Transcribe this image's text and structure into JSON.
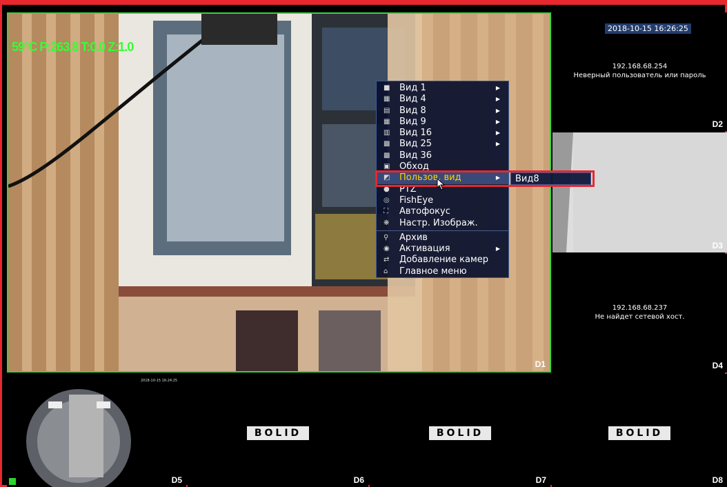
{
  "tiles": {
    "main": {
      "channel": "D1",
      "ptz_overlay": "59°C P:263.8 T:0.0 Z:1.0"
    },
    "right1": {
      "channel": "D2",
      "timestamp": "2018-10-15 16:26:25",
      "ip": "192.168.68.254",
      "message": "Неверный пользователь или пароль"
    },
    "right2": {
      "channel": "D3"
    },
    "right3": {
      "channel": "D4",
      "ip": "192.168.68.237",
      "message": "Не найдет сетевой хост."
    },
    "bottom1": {
      "channel": "D5",
      "timestamp": "2018-10-15 16:24:25"
    },
    "bottom2": {
      "channel": "D6",
      "logo": "BOLID"
    },
    "bottom3": {
      "channel": "D7",
      "logo": "BOLID"
    },
    "bottom4": {
      "channel": "D8",
      "logo": "BOLID"
    }
  },
  "menu": {
    "items": [
      {
        "label": "Вид 1",
        "icon": "layout-1-icon",
        "has_sub": true
      },
      {
        "label": "Вид 4",
        "icon": "layout-4-icon",
        "has_sub": true
      },
      {
        "label": "Вид 8",
        "icon": "layout-8-icon",
        "has_sub": true
      },
      {
        "label": "Вид 9",
        "icon": "layout-9-icon",
        "has_sub": true
      },
      {
        "label": "Вид 16",
        "icon": "layout-16-icon",
        "has_sub": true
      },
      {
        "label": "Вид 25",
        "icon": "layout-25-icon",
        "has_sub": true
      },
      {
        "label": "Вид 36",
        "icon": "layout-36-icon",
        "has_sub": false
      },
      {
        "label": "Обход",
        "icon": "tour-icon",
        "has_sub": false
      },
      {
        "label": "Пользов. вид",
        "icon": "custom-view-icon",
        "has_sub": true,
        "active": true
      },
      {
        "label": "PTZ",
        "icon": "ptz-icon",
        "has_sub": false
      },
      {
        "label": "FishEye",
        "icon": "fisheye-icon",
        "has_sub": false
      },
      {
        "label": "Автофокус",
        "icon": "autofocus-icon",
        "has_sub": false
      },
      {
        "label": "Настр. Изображ.",
        "icon": "image-settings-icon",
        "has_sub": false
      },
      {
        "label": "Архив",
        "icon": "search-icon",
        "has_sub": false
      },
      {
        "label": "Активация",
        "icon": "activation-icon",
        "has_sub": true
      },
      {
        "label": "Добавление камер",
        "icon": "add-camera-icon",
        "has_sub": false
      },
      {
        "label": "Главное меню",
        "icon": "home-icon",
        "has_sub": false
      }
    ],
    "submenu_item": "Вид8"
  },
  "colors": {
    "highlight": "#e8272f",
    "active_border": "#3bd43b",
    "menu_active_text": "#ffd400"
  }
}
